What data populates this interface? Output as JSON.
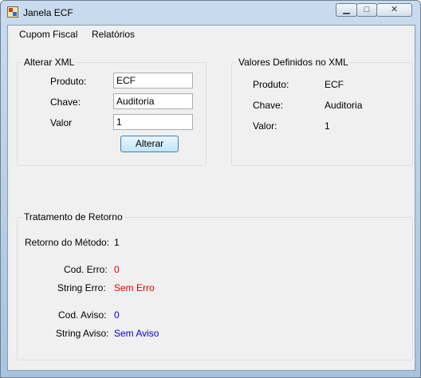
{
  "window": {
    "title": "Janela ECF",
    "minimize": "▁",
    "maximize": "□",
    "close": "✕"
  },
  "menu": {
    "items": [
      "Cupom Fiscal",
      "Relatórios"
    ]
  },
  "alterar": {
    "title": "Alterar XML",
    "produto_label": "Produto:",
    "produto_value": "ECF",
    "chave_label": "Chave:",
    "chave_value": "Auditoria",
    "valor_label": "Valor",
    "valor_value": "1",
    "button": "Alterar"
  },
  "definidos": {
    "title": "Valores Definidos no XML",
    "produto_label": "Produto:",
    "produto_value": "ECF",
    "chave_label": "Chave:",
    "chave_value": "Auditoria",
    "valor_label": "Valor:",
    "valor_value": "1"
  },
  "retorno": {
    "title": "Tratamento de Retorno",
    "metodo_label": "Retorno do Método:",
    "metodo_value": "1",
    "cod_erro_label": "Cod. Erro:",
    "cod_erro_value": "0",
    "string_erro_label": "String Erro:",
    "string_erro_value": "Sem Erro",
    "cod_aviso_label": "Cod. Aviso:",
    "cod_aviso_value": "0",
    "string_aviso_label": "String Aviso:",
    "string_aviso_value": "Sem Aviso"
  },
  "colors": {
    "error": "#e00000",
    "warning": "#0000e0"
  }
}
